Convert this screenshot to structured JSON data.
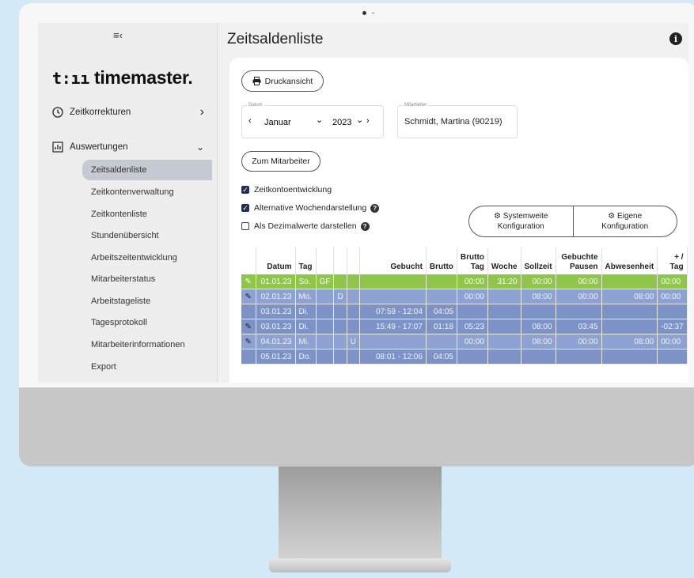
{
  "sidebar": {
    "toggle_icon": "≡‹",
    "logo_mark": "t:ıı",
    "logo_text": "timemaster.",
    "groups": [
      {
        "label": "Zeitkorrekturen",
        "icon": "clock-icon"
      },
      {
        "label": "Auswertungen",
        "icon": "chart-icon"
      }
    ],
    "items": [
      {
        "label": "Zeitsaldenliste"
      },
      {
        "label": "Zeitkontenverwaltung"
      },
      {
        "label": "Zeitkontenliste"
      },
      {
        "label": "Stundenübersicht"
      },
      {
        "label": "Arbeitszeitentwicklung"
      },
      {
        "label": "Mitarbeiterstatus"
      },
      {
        "label": "Arbeitstageliste"
      },
      {
        "label": "Tagesprotokoll"
      },
      {
        "label": "Mitarbeiterinformationen"
      },
      {
        "label": "Export"
      }
    ]
  },
  "main": {
    "title": "Zeitsaldenliste",
    "print_label": "Druckansicht",
    "date_label": "Datum",
    "month": "Januar",
    "year": "2023",
    "employee_label": "Mitarbeiter",
    "employee": "Schmidt, Martina (90219)",
    "to_employee": "Zum Mitarbeiter",
    "checks": [
      {
        "label": "Zeitkontoentwicklung",
        "checked": true
      },
      {
        "label": "Alternative Wochendarstellung",
        "checked": true
      },
      {
        "label": "Als Dezimalwerte darstellen",
        "checked": false
      }
    ],
    "config": {
      "system_1": "Systemweite",
      "system_2": "Konfiguration",
      "own_1": "Eigene",
      "own_2": "Konfiguration"
    }
  },
  "table": {
    "headers": {
      "datum": "Datum",
      "tag": "Tag",
      "gebucht": "Gebucht",
      "brutto": "Brutto",
      "brutto_tag_1": "Brutto",
      "brutto_tag_2": "Tag",
      "woche": "Woche",
      "sollzeit": "Sollzeit",
      "geb_pausen_1": "Gebuchte",
      "geb_pausen_2": "Pausen",
      "abwesenheit": "Abwesenheit",
      "plusminus_1": "+ /",
      "plusminus_2": "Tag"
    },
    "rows": [
      {
        "style": "green",
        "edit": true,
        "datum": "01.01.23",
        "tag": "So.",
        "c1": "GF",
        "c2": "",
        "c3": "",
        "gebucht": "",
        "brutto": "",
        "brutto_tag": "00:00",
        "woche": "31:20",
        "sollzeit": "00:00",
        "pausen": "00:00",
        "abwesenheit": "",
        "plus": "00:00"
      },
      {
        "style": "blue",
        "edit": true,
        "datum": "02.01.23",
        "tag": "Mo.",
        "c1": "",
        "c2": "D",
        "c3": "",
        "gebucht": "",
        "brutto": "",
        "brutto_tag": "00:00",
        "woche": "",
        "sollzeit": "08:00",
        "pausen": "00:00",
        "abwesenheit": "08:00",
        "plus": "00:00"
      },
      {
        "style": "dark",
        "edit": false,
        "datum": "03.01.23",
        "tag": "Di.",
        "c1": "",
        "c2": "",
        "c3": "",
        "gebucht": "07:59  -  12:04",
        "brutto": "04:05",
        "brutto_tag": "",
        "woche": "",
        "sollzeit": "",
        "pausen": "",
        "abwesenheit": "",
        "plus": ""
      },
      {
        "style": "dark",
        "edit": true,
        "datum": "03.01.23",
        "tag": "Di.",
        "c1": "",
        "c2": "",
        "c3": "",
        "gebucht": "15:49  -  17:07",
        "brutto": "01:18",
        "brutto_tag": "05:23",
        "woche": "",
        "sollzeit": "08:00",
        "pausen": "03:45",
        "abwesenheit": "",
        "plus": "-02:37"
      },
      {
        "style": "blue",
        "edit": true,
        "datum": "04.01.23",
        "tag": "Mi.",
        "c1": "",
        "c2": "",
        "c3": "U",
        "gebucht": "",
        "brutto": "",
        "brutto_tag": "00:00",
        "woche": "",
        "sollzeit": "08:00",
        "pausen": "00:00",
        "abwesenheit": "08:00",
        "plus": "00:00"
      },
      {
        "style": "dark",
        "edit": false,
        "datum": "05.01.23",
        "tag": "Do.",
        "c1": "",
        "c2": "",
        "c3": "",
        "gebucht": "08:01  -  12:06",
        "brutto": "04:05",
        "brutto_tag": "",
        "woche": "",
        "sollzeit": "",
        "pausen": "",
        "abwesenheit": "",
        "plus": ""
      }
    ]
  },
  "colors": {
    "green_row": "#8fc64a",
    "blue_row": "#8da2d2",
    "dark_row": "#7d93c8",
    "active_nav": "#c5c9d2"
  }
}
